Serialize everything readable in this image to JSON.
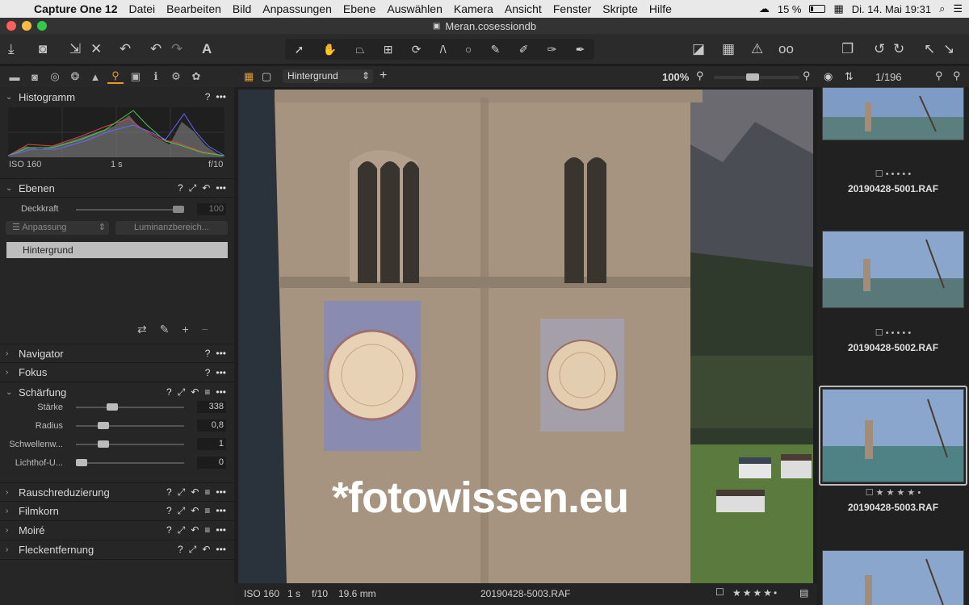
{
  "menubar": {
    "app": "Capture One 12",
    "items": [
      "Datei",
      "Bearbeiten",
      "Bild",
      "Anpassungen",
      "Ebene",
      "Auswählen",
      "Kamera",
      "Ansicht",
      "Fenster",
      "Skripte",
      "Hilfe"
    ],
    "battery": "15 %",
    "datetime": "Di. 14. Mai  19:31"
  },
  "window": {
    "title": "Meran.cosessiondb"
  },
  "left_panel": {
    "histogram": {
      "title": "Histogramm",
      "iso": "ISO 160",
      "shutter": "1 s",
      "aperture": "f/10"
    },
    "ebenen": {
      "title": "Ebenen",
      "deckkraft_label": "Deckkraft",
      "deckkraft_value": "100",
      "anpassung_label": "Anpassung",
      "luminanz_label": "Luminanzbereich...",
      "layer_name": "Hintergrund"
    },
    "sections_collapsed_top": [
      "Navigator",
      "Fokus"
    ],
    "schaerfung": {
      "title": "Schärfung",
      "rows": [
        {
          "label": "Stärke",
          "value": "338",
          "level": 0.28
        },
        {
          "label": "Radius",
          "value": "0,8",
          "level": 0.2
        },
        {
          "label": "Schwellenw...",
          "value": "1",
          "level": 0.2
        },
        {
          "label": "Lichthof-U...",
          "value": "0",
          "level": 0.0
        }
      ]
    },
    "sections_collapsed_bottom": [
      "Rauschreduzierung",
      "Filmkorn",
      "Moiré",
      "Fleckentfernung"
    ]
  },
  "viewer_top": {
    "layer_select": "Hintergrund",
    "zoom": "100%"
  },
  "viewer": {
    "watermark": "*fotowissen.eu"
  },
  "statusbar": {
    "iso": "ISO 160",
    "shutter": "1 s",
    "aperture": "f/10",
    "focal": "19.6 mm",
    "filename": "20190428-5003.RAF"
  },
  "browser": {
    "counter": "1/196",
    "items": [
      {
        "filename": "20190428-5001.RAF",
        "rating": "☐ • • • • •"
      },
      {
        "filename": "20190428-5002.RAF",
        "rating": "☐ • • • • •"
      },
      {
        "filename": "20190428-5003.RAF",
        "rating": "☐ ★ ★ ★ ★ •"
      }
    ]
  },
  "colors": {
    "accent": "#e89a2c",
    "panel": "#262626",
    "selected_border": "#bdbdbd"
  }
}
